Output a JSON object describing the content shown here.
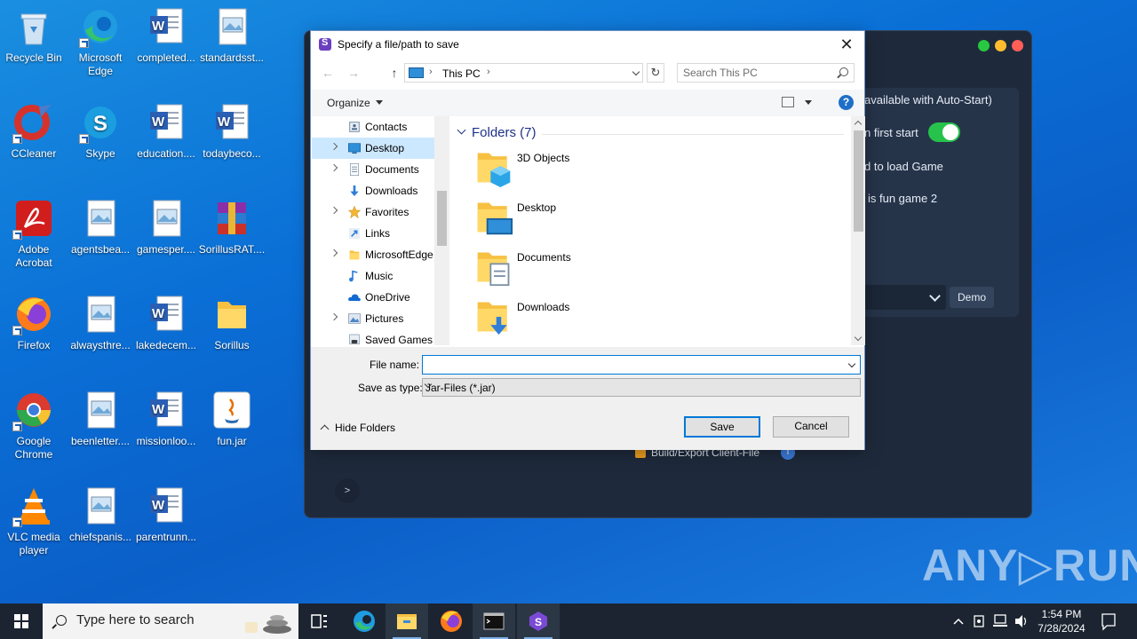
{
  "desktop": {
    "icons": [
      {
        "label": "Recycle Bin",
        "icon": "recycle-bin-icon"
      },
      {
        "label": "Microsoft Edge",
        "icon": "edge-icon"
      },
      {
        "label": "completed...",
        "icon": "word-doc-icon"
      },
      {
        "label": "standardsst...",
        "icon": "image-file-icon"
      },
      {
        "label": "CCleaner",
        "icon": "ccleaner-icon"
      },
      {
        "label": "Skype",
        "icon": "skype-icon"
      },
      {
        "label": "education....",
        "icon": "word-doc-icon"
      },
      {
        "label": "todaybeco...",
        "icon": "word-doc-icon"
      },
      {
        "label": "Adobe Acrobat",
        "icon": "acrobat-icon"
      },
      {
        "label": "agentsbea...",
        "icon": "image-file-icon"
      },
      {
        "label": "gamesper....",
        "icon": "image-file-icon"
      },
      {
        "label": "SorillusRAT....",
        "icon": "winrar-icon"
      },
      {
        "label": "Firefox",
        "icon": "firefox-icon"
      },
      {
        "label": "alwaysthre...",
        "icon": "image-file-icon"
      },
      {
        "label": "lakedecem...",
        "icon": "word-doc-icon"
      },
      {
        "label": "Sorillus",
        "icon": "folder-icon"
      },
      {
        "label": "Google Chrome",
        "icon": "chrome-icon"
      },
      {
        "label": "beenletter....",
        "icon": "image-file-icon"
      },
      {
        "label": "missionloo...",
        "icon": "word-doc-icon"
      },
      {
        "label": "fun.jar",
        "icon": "java-icon"
      },
      {
        "label": "VLC media player",
        "icon": "vlc-icon"
      },
      {
        "label": "chiefspanis...",
        "icon": "image-file-icon"
      },
      {
        "label": "parentrunn...",
        "icon": "word-doc-icon"
      }
    ]
  },
  "background_app": {
    "texts": {
      "autostart": "available with Auto-Start)",
      "first_start": "n first start",
      "load_game": "d to load Game",
      "fun_game": "is fun game 2"
    },
    "demo_label": "Demo",
    "export_label": "Build/Export Client-File",
    "info_label": "i",
    "prompt_label": ">",
    "colors": {
      "close": "#ff5f57",
      "minimize": "#febc2e",
      "maximize": "#28c840",
      "toggle_on": "#27c24c"
    }
  },
  "dialog": {
    "title": "Specify a file/path to save",
    "close_glyph": "✕",
    "nav": {
      "back": "←",
      "forward": "→",
      "up": "↑"
    },
    "address": {
      "crumb": "This PC",
      "sep": "›"
    },
    "refresh_glyph": "↻",
    "search_placeholder": "Search This PC",
    "organize_label": "Organize",
    "help_glyph": "?",
    "tree": [
      {
        "label": "Contacts",
        "icon": "contacts-icon",
        "expandable": false,
        "selected": false
      },
      {
        "label": "Desktop",
        "icon": "desktop-folder-icon",
        "expandable": true,
        "selected": true
      },
      {
        "label": "Documents",
        "icon": "documents-icon",
        "expandable": true,
        "selected": false
      },
      {
        "label": "Downloads",
        "icon": "downloads-icon",
        "expandable": false,
        "selected": false
      },
      {
        "label": "Favorites",
        "icon": "favorites-star-icon",
        "expandable": true,
        "selected": false
      },
      {
        "label": "Links",
        "icon": "links-icon",
        "expandable": false,
        "selected": false
      },
      {
        "label": "MicrosoftEdge",
        "icon": "folder-icon",
        "expandable": true,
        "selected": false
      },
      {
        "label": "Music",
        "icon": "music-icon",
        "expandable": false,
        "selected": false
      },
      {
        "label": "OneDrive",
        "icon": "onedrive-icon",
        "expandable": false,
        "selected": false
      },
      {
        "label": "Pictures",
        "icon": "pictures-icon",
        "expandable": true,
        "selected": false
      },
      {
        "label": "Saved Games",
        "icon": "saved-games-icon",
        "expandable": false,
        "selected": false
      }
    ],
    "group_header": "Folders (7)",
    "folders": [
      {
        "label": "3D Objects",
        "icon": "3d-objects-folder-icon"
      },
      {
        "label": "Desktop",
        "icon": "desktop-folder-icon"
      },
      {
        "label": "Documents",
        "icon": "documents-folder-icon"
      },
      {
        "label": "Downloads",
        "icon": "downloads-folder-icon"
      }
    ],
    "file_name_label": "File name:",
    "file_name_value": "",
    "save_type_label": "Save as type:",
    "save_type_value": "Jar-Files (*.jar)",
    "hide_folders_label": "Hide Folders",
    "save_label": "Save",
    "cancel_label": "Cancel"
  },
  "watermark": "ANY▷RUN",
  "taskbar": {
    "search_placeholder": "Type here to search",
    "apps": [
      "task-view-icon",
      "edge-icon",
      "file-explorer-icon",
      "firefox-icon",
      "terminal-icon",
      "sorillus-icon"
    ],
    "clock_time": "1:54 PM",
    "clock_date": "7/28/2024"
  }
}
